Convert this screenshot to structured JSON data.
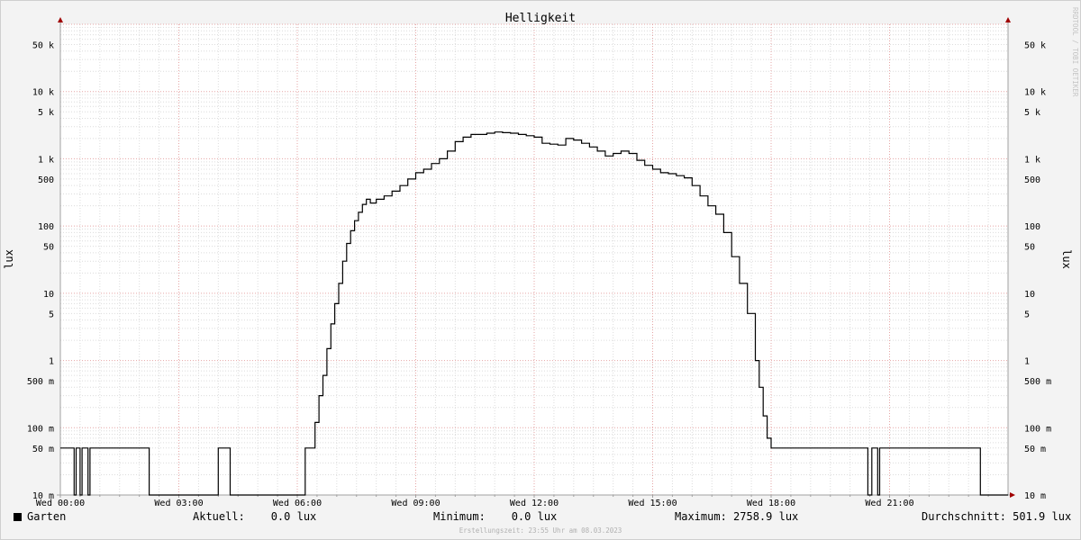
{
  "chart_data": {
    "type": "line",
    "title": "Helligkeit",
    "ylabel": "lux",
    "y_scale": "log",
    "ylim": [
      0.01,
      100000
    ],
    "xlim": [
      0,
      24
    ],
    "x_ticks": [
      {
        "x": 0,
        "label": "Wed 00:00"
      },
      {
        "x": 3,
        "label": "Wed 03:00"
      },
      {
        "x": 6,
        "label": "Wed 06:00"
      },
      {
        "x": 9,
        "label": "Wed 09:00"
      },
      {
        "x": 12,
        "label": "Wed 12:00"
      },
      {
        "x": 15,
        "label": "Wed 15:00"
      },
      {
        "x": 18,
        "label": "Wed 18:00"
      },
      {
        "x": 21,
        "label": "Wed 21:00"
      }
    ],
    "y_ticks": [
      {
        "v": 0.01,
        "label": "10 m"
      },
      {
        "v": 0.05,
        "label": "50 m"
      },
      {
        "v": 0.1,
        "label": "100 m"
      },
      {
        "v": 0.5,
        "label": "500 m"
      },
      {
        "v": 1,
        "label": "1"
      },
      {
        "v": 5,
        "label": "5"
      },
      {
        "v": 10,
        "label": "10"
      },
      {
        "v": 50,
        "label": "50"
      },
      {
        "v": 100,
        "label": "100"
      },
      {
        "v": 500,
        "label": "500"
      },
      {
        "v": 1000,
        "label": "1 k"
      },
      {
        "v": 5000,
        "label": "5 k"
      },
      {
        "v": 10000,
        "label": "10 k"
      },
      {
        "v": 50000,
        "label": "50 k"
      }
    ],
    "grid": true,
    "series": [
      {
        "name": "Garten",
        "color": "#000000",
        "x": [
          0.0,
          0.3,
          0.35,
          0.4,
          0.45,
          0.5,
          0.55,
          0.6,
          0.7,
          0.75,
          0.8,
          2.2,
          2.25,
          3.95,
          4.0,
          4.25,
          4.3,
          6.15,
          6.2,
          6.4,
          6.45,
          6.55,
          6.65,
          6.75,
          6.85,
          6.95,
          7.05,
          7.15,
          7.25,
          7.35,
          7.45,
          7.55,
          7.65,
          7.75,
          7.85,
          8.0,
          8.2,
          8.4,
          8.6,
          8.8,
          9.0,
          9.2,
          9.4,
          9.6,
          9.8,
          10.0,
          10.2,
          10.4,
          10.6,
          10.8,
          11.0,
          11.2,
          11.4,
          11.6,
          11.8,
          12.0,
          12.2,
          12.4,
          12.6,
          12.8,
          13.0,
          13.2,
          13.4,
          13.6,
          13.8,
          14.0,
          14.2,
          14.4,
          14.6,
          14.8,
          15.0,
          15.2,
          15.4,
          15.6,
          15.8,
          16.0,
          16.2,
          16.4,
          16.6,
          16.8,
          17.0,
          17.2,
          17.4,
          17.6,
          17.7,
          17.8,
          17.9,
          18.0,
          18.1,
          18.2,
          18.3,
          18.4,
          18.5,
          18.6,
          18.7,
          18.8,
          18.9,
          19.0,
          19.1,
          19.15,
          19.2,
          19.3,
          20.4,
          20.45,
          20.55,
          20.6,
          20.7,
          20.75,
          20.9,
          20.95,
          23.25,
          23.3,
          24.0
        ],
        "values": [
          0.05,
          0.05,
          0.01,
          0.05,
          0.05,
          0.01,
          0.05,
          0.05,
          0.01,
          0.05,
          0.05,
          0.05,
          0.01,
          0.01,
          0.05,
          0.05,
          0.01,
          0.01,
          0.05,
          0.05,
          0.12,
          0.3,
          0.6,
          1.5,
          3.5,
          7.0,
          14.0,
          30.0,
          55.0,
          85.0,
          120.0,
          160.0,
          210.0,
          250.0,
          220.0,
          250.0,
          280.0,
          330.0,
          400.0,
          500.0,
          620.0,
          700.0,
          850.0,
          1000.0,
          1300.0,
          1800.0,
          2100.0,
          2300.0,
          2300.0,
          2400.0,
          2500.0,
          2450.0,
          2400.0,
          2300.0,
          2200.0,
          2100.0,
          1700.0,
          1650.0,
          1600.0,
          2000.0,
          1900.0,
          1700.0,
          1500.0,
          1300.0,
          1100.0,
          1200.0,
          1300.0,
          1200.0,
          950.0,
          800.0,
          700.0,
          620.0,
          600.0,
          560.0,
          520.0,
          400.0,
          280.0,
          200.0,
          150.0,
          80.0,
          35.0,
          14.0,
          5.0,
          1.0,
          0.4,
          0.15,
          0.07,
          0.05,
          0.05,
          0.05,
          0.05,
          0.05,
          0.05,
          0.05,
          0.05,
          0.05,
          0.05,
          0.05,
          0.05,
          0.05,
          0.05,
          0.05,
          0.05,
          0.01,
          0.05,
          0.05,
          0.01,
          0.05,
          0.05,
          0.05,
          0.05,
          0.01,
          0.01
        ]
      }
    ]
  },
  "legend": {
    "series_name": "Garten",
    "aktuell": "Aktuell:    0.0 lux",
    "minimum": "Minimum:    0.0 lux",
    "maximum": "Maximum: 2758.9 lux",
    "durchschnitt": "Durchschnitt: 501.9 lux"
  },
  "footer": "Erstellungszeit: 23:55 Uhr am 08.03.2023",
  "watermark": "RRDTOOL / TOBI OETIKER",
  "colors": {
    "background": "#f3f3f3",
    "plot_background": "#ffffff",
    "grid_minor": "#dcdcdc",
    "grid_major": "#e5a5a5",
    "axis": "#a0a0a0",
    "arrow": "#a00000"
  }
}
